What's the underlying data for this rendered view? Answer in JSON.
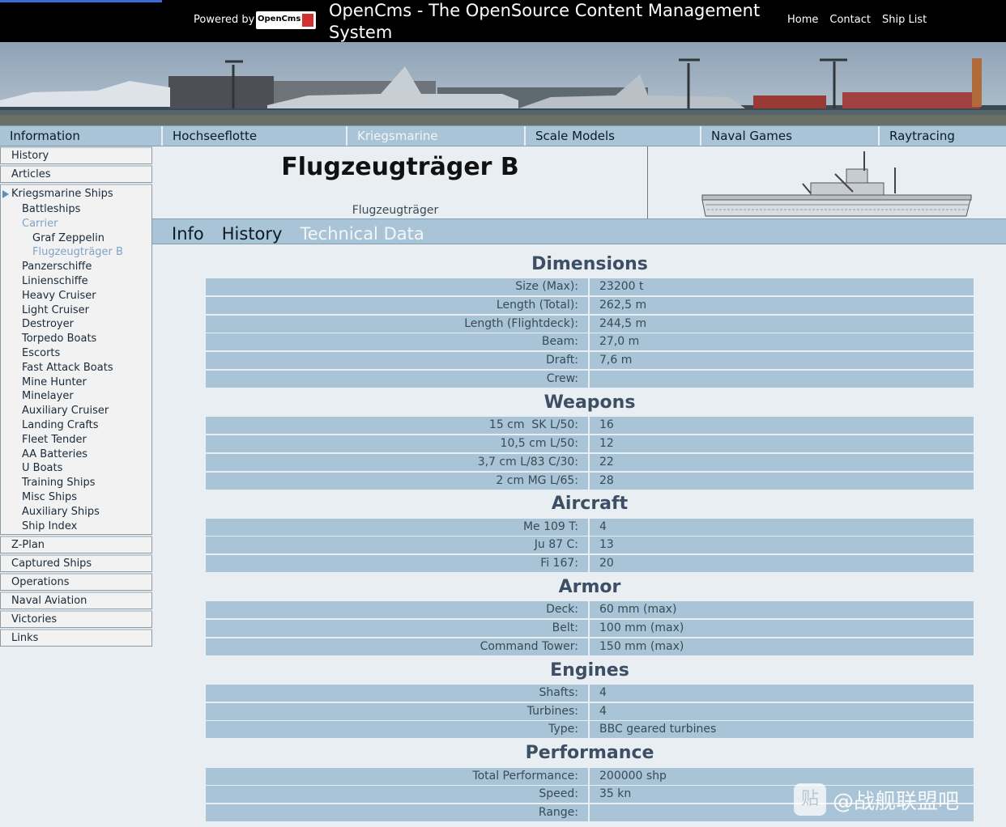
{
  "topbar": {
    "powered_by": "Powered by",
    "logo_text": "OpenCms",
    "site_title": "OpenCms - The OpenSource Content Management System",
    "links": [
      "Home",
      "Contact",
      "Ship List"
    ]
  },
  "main_nav": {
    "items": [
      "Information",
      "Hochseeflotte",
      "Kriegsmarine",
      "Scale Models",
      "Naval Games",
      "Raytracing"
    ],
    "active": "Kriegsmarine"
  },
  "sidebar": {
    "top_items": [
      "History",
      "Articles"
    ],
    "group_label": "Kriegsmarine Ships",
    "group_items": [
      "Battleships",
      "Carrier",
      "Graf Zeppelin",
      "Flugzeugträger B",
      "Panzerschiffe",
      "Linienschiffe",
      "Heavy Cruiser",
      "Light Cruiser",
      "Destroyer",
      "Torpedo Boats",
      "Escorts",
      "Fast Attack Boats",
      "Mine Hunter",
      "Minelayer",
      "Auxiliary Cruiser",
      "Landing Crafts",
      "Fleet Tender",
      "AA Batteries",
      "U Boats",
      "Training Ships",
      "Misc Ships",
      "Auxiliary Ships",
      "Ship Index"
    ],
    "bottom_items": [
      "Z-Plan",
      "Captured Ships",
      "Operations",
      "Naval Aviation",
      "Victories",
      "Links"
    ]
  },
  "ship": {
    "name": "Flugzeugträger B",
    "type": "Flugzeugträger"
  },
  "tabs": {
    "items": [
      "Info",
      "History",
      "Technical Data"
    ],
    "active": "Technical Data"
  },
  "sections": [
    {
      "title": "Dimensions",
      "rows": [
        [
          "Size (Max):",
          "23200 t"
        ],
        [
          "Length (Total):",
          "262,5 m"
        ],
        [
          "Length (Flightdeck):",
          "244,5 m"
        ],
        [
          "Beam:",
          "27,0 m"
        ],
        [
          "Draft:",
          "7,6 m"
        ],
        [
          "Crew:",
          ""
        ]
      ]
    },
    {
      "title": "Weapons",
      "rows": [
        [
          "15 cm  SK L/50:",
          "16"
        ],
        [
          "10,5 cm L/50:",
          "12"
        ],
        [
          "3,7 cm L/83 C/30:",
          "22"
        ],
        [
          "2 cm MG L/65:",
          "28"
        ]
      ]
    },
    {
      "title": "Aircraft",
      "rows": [
        [
          "Me 109 T:",
          "4"
        ],
        [
          "Ju 87 C:",
          "13"
        ],
        [
          "Fi 167:",
          "20"
        ]
      ]
    },
    {
      "title": "Armor",
      "rows": [
        [
          "Deck:",
          "60 mm (max)"
        ],
        [
          "Belt:",
          "100 mm (max)"
        ],
        [
          "Command Tower:",
          "150 mm (max)"
        ]
      ]
    },
    {
      "title": "Engines",
      "rows": [
        [
          "Shafts:",
          "4"
        ],
        [
          "Turbines:",
          "4"
        ],
        [
          "Type:",
          "BBC geared turbines"
        ]
      ]
    },
    {
      "title": "Performance",
      "rows": [
        [
          "Total Performance:",
          "200000 shp"
        ],
        [
          "Speed:",
          "35 kn"
        ],
        [
          "Range:",
          ""
        ]
      ]
    }
  ],
  "watermark": {
    "badge": "贴",
    "text": "@战舰联盟吧"
  },
  "colors": {
    "nav_bg": "#a8c4d6",
    "page_bg": "#e8eef1",
    "active_link": "#7fa3c6",
    "section_title": "#3c4f64"
  }
}
